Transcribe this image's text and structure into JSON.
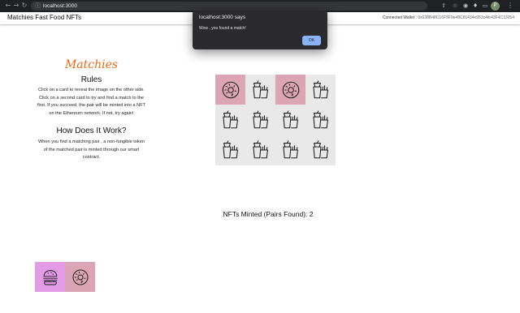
{
  "browser": {
    "url": "localhost:3000",
    "profile_initial": "P",
    "icons": [
      "back-icon",
      "forward-icon",
      "reload-icon",
      "lock-icon",
      "share-icon",
      "star-icon",
      "extension-icon",
      "puzzle-icon",
      "sidebar-icon",
      "kebab-icon"
    ]
  },
  "header": {
    "brand": "Matchies Fast Food NFTs",
    "wallet_label": "Connected Wallet : ",
    "wallet_address": "0x638B48C16F5F9e48C81434e953c4fe43F4C13054"
  },
  "intro": {
    "logo": "Matchies",
    "rules_heading": "Rules",
    "rules_text": "Click on a card to reveal the image on the other side. Click on a second card to try and find a match to the first. If you succeed, the pair will be minted into a NFT on the Ethereum network. If not, try again!",
    "how_heading": "How Does It Work?",
    "how_text": "When you find a matching pair , a non-fungible token of the matched pair is minted through our smart contract."
  },
  "board": {
    "cards": [
      {
        "icon": "donut",
        "state": "found"
      },
      {
        "icon": "fries",
        "state": "hidden"
      },
      {
        "icon": "donut",
        "state": "found"
      },
      {
        "icon": "fries",
        "state": "hidden"
      },
      {
        "icon": "fries",
        "state": "hidden"
      },
      {
        "icon": "fries",
        "state": "hidden"
      },
      {
        "icon": "fries",
        "state": "hidden"
      },
      {
        "icon": "fries",
        "state": "hidden"
      },
      {
        "icon": "fries",
        "state": "hidden"
      },
      {
        "icon": "fries",
        "state": "hidden"
      },
      {
        "icon": "fries",
        "state": "hidden"
      },
      {
        "icon": "fries",
        "state": "hidden"
      }
    ],
    "found_color": "#dca5b6",
    "back_color": "#e8e8e8"
  },
  "status": {
    "minted_label": "NFTs Minted (Pairs Found): 2"
  },
  "collection": [
    {
      "icon": "burger",
      "bg": "#e39be8"
    },
    {
      "icon": "donut",
      "bg": "#dca5b6"
    }
  ],
  "alert": {
    "title": "localhost:3000 says",
    "message": "Wow , you found a match!",
    "ok_label": "OK"
  }
}
